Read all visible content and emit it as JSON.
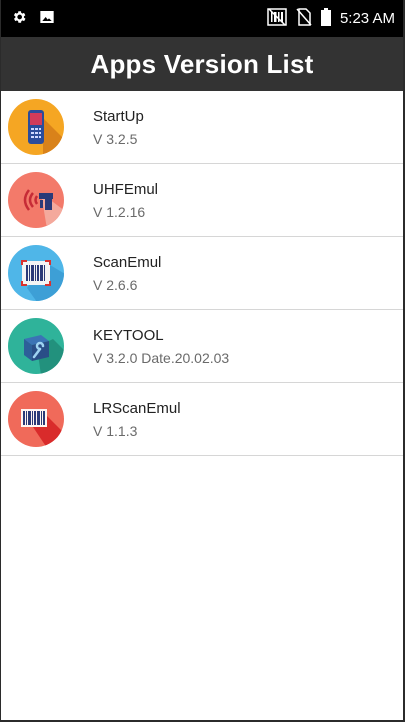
{
  "status_bar": {
    "time": "5:23 AM",
    "left_icons": [
      "gear-icon",
      "image-icon"
    ],
    "right_icons": [
      "nfc-barcode-icon",
      "no-sim-icon",
      "battery-icon"
    ]
  },
  "header": {
    "title": "Apps Version List"
  },
  "apps": [
    {
      "name": "StartUp",
      "version": "V 3.2.5",
      "icon": "startup-icon",
      "color": "#f5a623"
    },
    {
      "name": "UHFEmul",
      "version": "V 1.2.16",
      "icon": "uhf-icon",
      "color": "#f37a6a"
    },
    {
      "name": "ScanEmul",
      "version": "V 2.6.6",
      "icon": "scan-icon",
      "color": "#4fb6e8"
    },
    {
      "name": "KEYTOOL",
      "version": "V 3.2.0 Date.20.02.03",
      "icon": "keytool-icon",
      "color": "#2fb39a"
    },
    {
      "name": "LRScanEmul",
      "version": "V 1.1.3",
      "icon": "lrscan-icon",
      "color": "#f06a5a"
    }
  ]
}
